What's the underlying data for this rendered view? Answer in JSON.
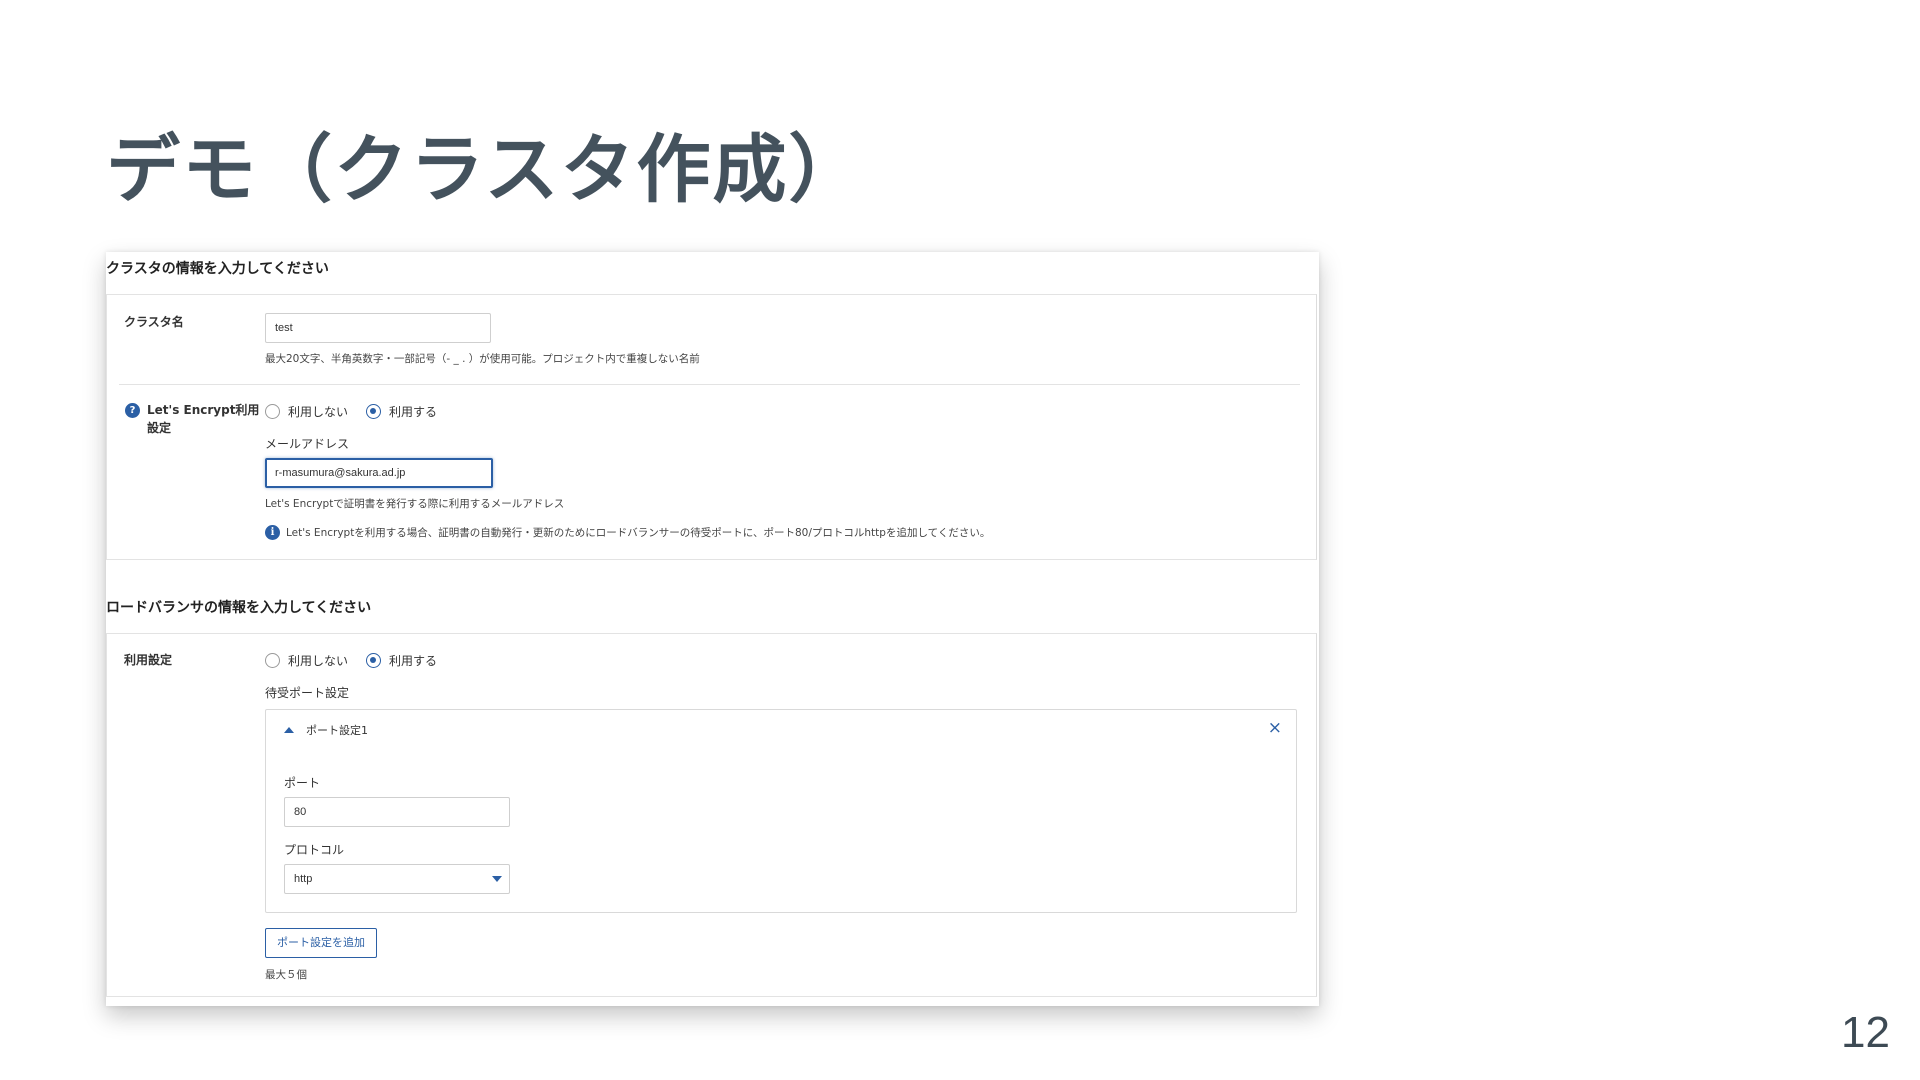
{
  "slide": {
    "title": "デモ（クラスタ作成）",
    "page_number": "12"
  },
  "cluster_section": {
    "heading": "クラスタの情報を入力してください",
    "name": {
      "label": "クラスタ名",
      "value": "test",
      "hint": "最大20文字、半角英数字・一部記号（- _ . ）が使用可能。プロジェクト内で重複しない名前"
    },
    "letsencrypt": {
      "label_line1": "Let's Encrypt利用",
      "label_line2": "設定",
      "help_glyph": "?",
      "option_off": "利用しない",
      "option_on": "利用する",
      "selected": "利用する",
      "email_label": "メールアドレス",
      "email_value": "r-masumura@sakura.ad.jp",
      "email_hint": "Let's Encryptで証明書を発行する際に利用するメールアドレス",
      "info_glyph": "i",
      "info_text": "Let's Encryptを利用する場合、証明書の自動発行・更新のためにロードバランサーの待受ポートに、ポート80/プロトコルhttpを追加してください。"
    }
  },
  "lb_section": {
    "heading": "ロードバランサの情報を入力してください",
    "usage": {
      "label": "利用設定",
      "option_off": "利用しない",
      "option_on": "利用する",
      "selected": "利用する"
    },
    "listen_ports_label": "待受ポート設定",
    "port_card": {
      "title": "ポート設定1",
      "close_glyph": "×",
      "port_label": "ポート",
      "port_value": "80",
      "protocol_label": "プロトコル",
      "protocol_value": "http"
    },
    "add_button_label": "ポート設定を追加",
    "max_note": "最大５個"
  },
  "colors": {
    "accent": "#2b5fa5",
    "title": "#44525d"
  },
  "icons": [
    "help-icon",
    "info-icon",
    "caret-up-icon",
    "close-icon",
    "chevron-down-icon"
  ]
}
